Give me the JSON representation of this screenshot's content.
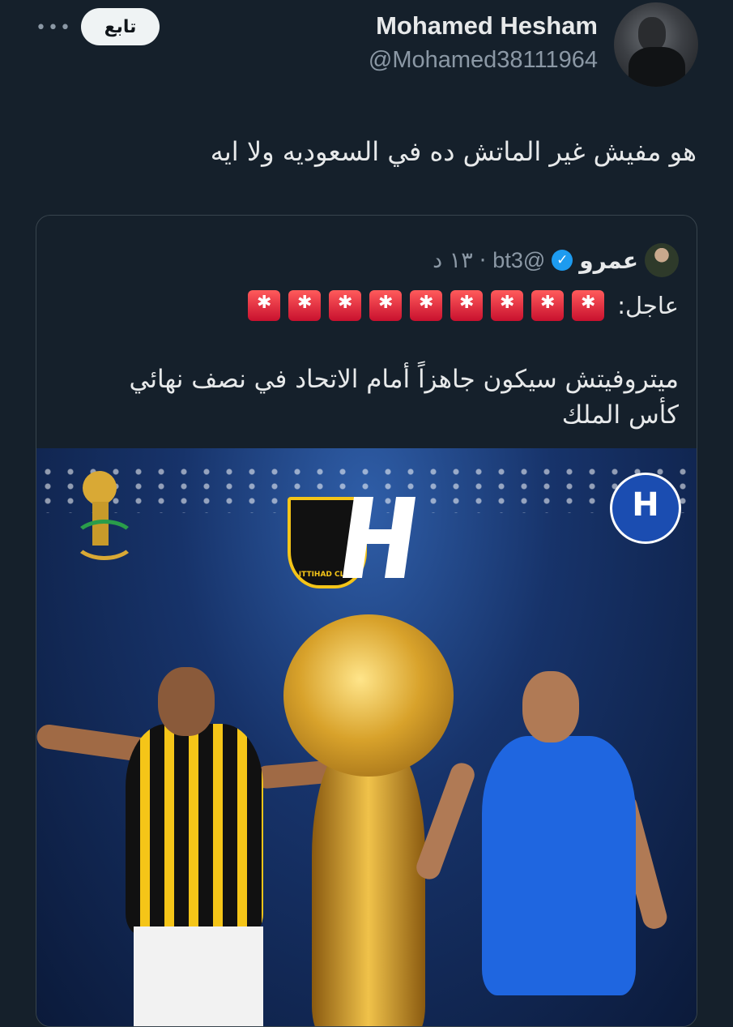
{
  "tweet": {
    "author_name": "Mohamed Hesham",
    "author_handle": "@Mohamed38111964",
    "follow_label": "تابع",
    "more_label": "•••",
    "text": "هو مفيش غير الماتش ده في السعوديه ولا ايه"
  },
  "quoted": {
    "author_name": "عمرو",
    "handle": "@bt3",
    "separator": "·",
    "date": "١٣ د",
    "alert_label": "عاجل:",
    "alert_icon": "police-siren",
    "alert_count": 9,
    "text_line1": "ميتروفيتش سيكون جاهزاً أمام الاتحاد في نصف نهائي",
    "text_line2": "كأس الملك",
    "image_caption_text": "ITTIHAD CLUB"
  },
  "colors": {
    "background": "#15202b",
    "verified": "#1d9bf0",
    "secondary_text": "#8b98a5"
  }
}
